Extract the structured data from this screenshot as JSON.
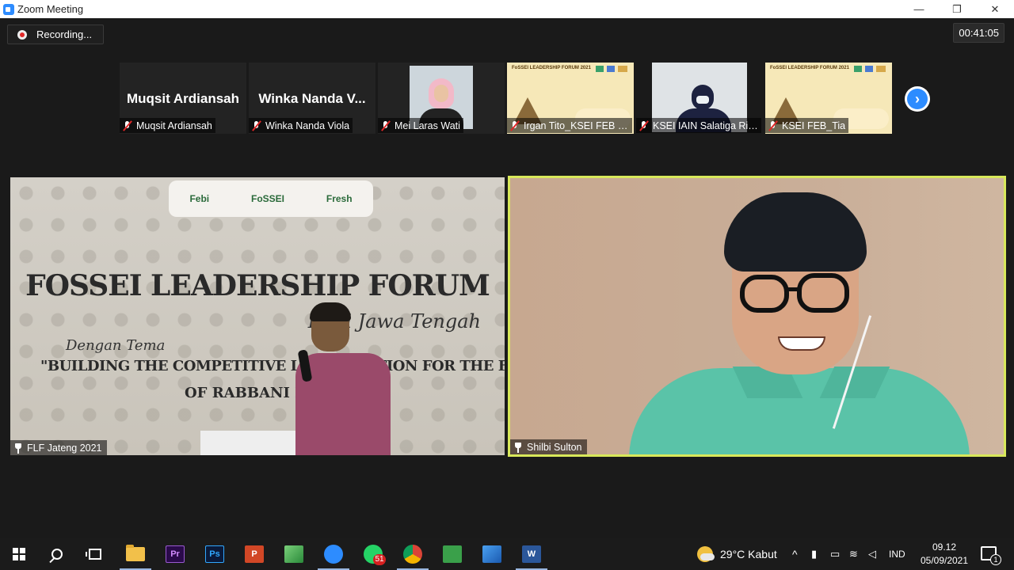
{
  "window": {
    "title": "Zoom Meeting",
    "minimize_glyph": "—",
    "restore_glyph": "❐",
    "close_glyph": "✕"
  },
  "meeting": {
    "recording_label": "Recording...",
    "timer": "00:41:05",
    "thumbnails": [
      {
        "display_name": "Muqsit Ardiansah",
        "name": "Muqsit Ardiansah",
        "muted": true
      },
      {
        "display_name": "Winka  Nanda  V...",
        "name": "Winka Nanda Viola",
        "muted": true
      },
      {
        "name": "Mei Laras Wati",
        "muted": true
      },
      {
        "name": "Irgan Tito_KSEI FEB U...",
        "muted": true,
        "poster_title": "FoSSEI LEADERSHIP FORUM 2021"
      },
      {
        "name": "KSEI IAIN Salatiga Rina...",
        "muted": true
      },
      {
        "name": "KSEI FEB_Tia",
        "muted": true,
        "poster_title": "FoSSEI LEADERSHIP FORUM 2021"
      }
    ],
    "next_glyph": "›",
    "main_left": {
      "name": "FLF Jateng 2021",
      "logos": [
        "Febi",
        "FoSSEI",
        "Fresh"
      ],
      "banner_title": "FOSSEI LEADERSHIP FORUM",
      "banner_sub": "Regi   Jawa Tengah",
      "banner_tema": "Dengan Tema",
      "banner_theme": "\"BUILDING THE COMPETITIVE LEADER O       TION FOR THE FUTURE",
      "banner_theme2": "OF RABBANI EC"
    },
    "main_right": {
      "name": "Shilbi Sulton",
      "active_speaker_color": "#d8e85a"
    }
  },
  "taskbar": {
    "apps": [
      {
        "id": "explorer",
        "label": ""
      },
      {
        "id": "premiere",
        "label": "Pr",
        "color": "#2a0a4a",
        "text_color": "#d38cff"
      },
      {
        "id": "photoshop",
        "label": "Ps",
        "color": "#0a1a3a",
        "text_color": "#31a8ff"
      },
      {
        "id": "powerpoint",
        "label": "P",
        "color": "#d24726",
        "text_color": "#ffffff"
      },
      {
        "id": "camtasia",
        "label": "",
        "color": "#3aa04a"
      },
      {
        "id": "zoom",
        "label": "",
        "color": "#2d8cff"
      },
      {
        "id": "whatsapp",
        "label": "",
        "color": "#25d366",
        "badge": "51"
      },
      {
        "id": "chrome",
        "label": "",
        "color": "#db4437"
      },
      {
        "id": "store",
        "label": "",
        "color": "#3aa04a"
      },
      {
        "id": "photos",
        "label": "",
        "color": "#2a7ad0"
      },
      {
        "id": "word",
        "label": "W",
        "color": "#2b579a",
        "text_color": "#ffffff"
      }
    ],
    "weather": "29°C  Kabut",
    "tray_chevron": "^",
    "language": "IND",
    "time": "09.12",
    "date": "05/09/2021",
    "notifications": "1"
  }
}
